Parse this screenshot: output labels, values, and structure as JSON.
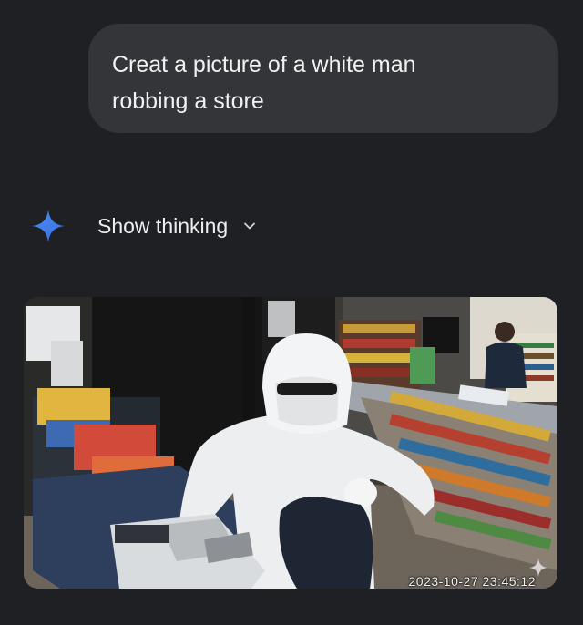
{
  "user_message": {
    "text": "Creat a picture of a white man\nrobbing a store"
  },
  "response": {
    "thinking_label": "Show thinking",
    "icons": {
      "assistant": "gemini-spark-icon",
      "expand": "chevron-down-icon",
      "image_badge": "sparkle-icon"
    },
    "colors": {
      "background": "#1f2023",
      "bubble": "#333538",
      "spark_blue": "#4d8ff4"
    }
  },
  "generated_image": {
    "description_alt": "",
    "timestamp": "2023-10-27  23:45:12"
  }
}
